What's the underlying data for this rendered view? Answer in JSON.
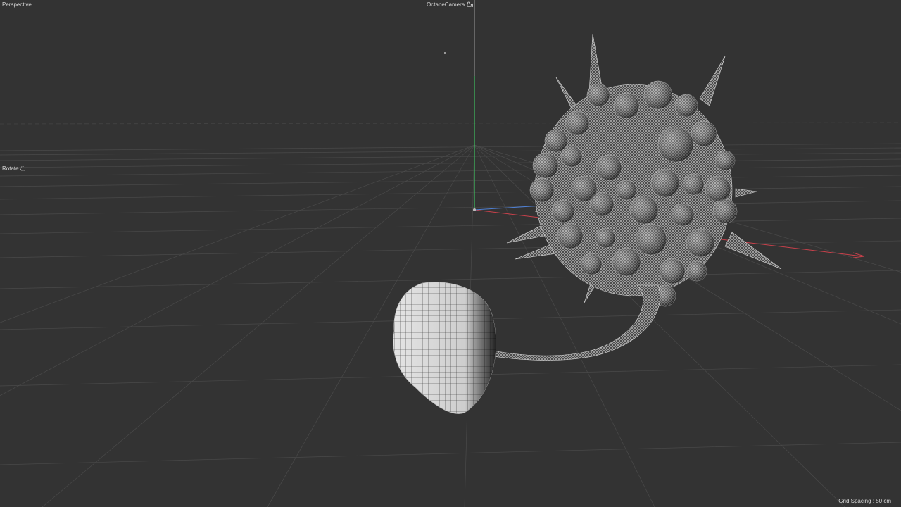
{
  "viewport": {
    "view_name": "Perspective",
    "camera_name": "OctaneCamera",
    "nav_mode": "Rotate",
    "grid_spacing": "Grid Spacing : 50 cm"
  },
  "icons": {
    "camera": "camera-lock-icon",
    "rotate": "rotate-icon"
  },
  "colors": {
    "background": "#333333",
    "grid": "#4a4a4a",
    "x_axis": "#c8414b",
    "y_axis": "#3fbf5f",
    "z_axis": "#4f7fd1",
    "mesh_light": "#e0e0e0",
    "mesh_dark": "#2a2a2a"
  }
}
